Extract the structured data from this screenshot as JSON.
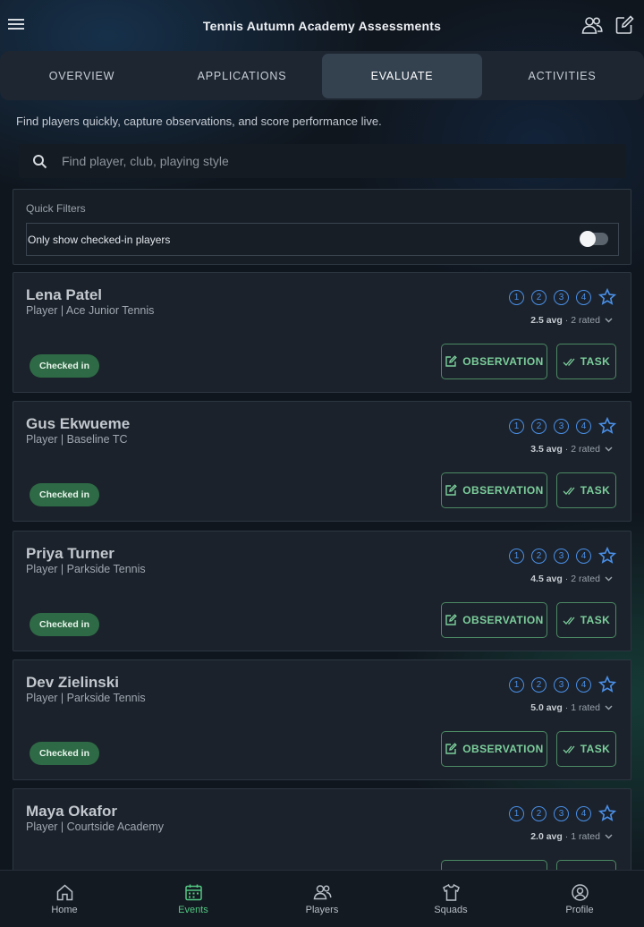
{
  "header": {
    "title": "Tennis Autumn Academy Assessments",
    "icons": {
      "menu": "hamburger-menu-icon",
      "team": "people-icon",
      "edit": "compose-icon"
    }
  },
  "tabs": [
    {
      "label": "OVERVIEW",
      "active": false
    },
    {
      "label": "APPLICATIONS",
      "active": false
    },
    {
      "label": "EVALUATE",
      "active": true
    },
    {
      "label": "ACTIVITIES",
      "active": false
    }
  ],
  "intro": "Find players quickly, capture observations, and score performance live.",
  "search": {
    "placeholder": "Find player, club, playing style",
    "value": ""
  },
  "filters": {
    "label": "Quick Filters",
    "checked_in_only_label": "Only show checked-in players",
    "checked_in_only": false
  },
  "rating_scale": [
    "1",
    "2",
    "3",
    "4"
  ],
  "players": [
    {
      "name": "Lena Patel",
      "sub": "Player | Ace Junior Tennis",
      "avg": "2.5 avg",
      "rated": "2 rated",
      "status": "Checked in"
    },
    {
      "name": "Gus Ekwueme",
      "sub": "Player | Baseline TC",
      "avg": "3.5 avg",
      "rated": "2 rated",
      "status": "Checked in"
    },
    {
      "name": "Priya Turner",
      "sub": "Player | Parkside Tennis",
      "avg": "4.5 avg",
      "rated": "2 rated",
      "status": "Checked in"
    },
    {
      "name": "Dev Zielinski",
      "sub": "Player | Parkside Tennis",
      "avg": "5.0 avg",
      "rated": "1 rated",
      "status": "Checked in"
    },
    {
      "name": "Maya Okafor",
      "sub": "Player | Courtside Academy",
      "avg": "2.0 avg",
      "rated": "1 rated",
      "status": ""
    }
  ],
  "actions": {
    "observation": "OBSERVATION",
    "task": "TASK",
    "rating_separator": "·"
  },
  "nav": [
    {
      "label": "Home",
      "icon": "home-icon",
      "active": false
    },
    {
      "label": "Events",
      "icon": "calendar-icon",
      "active": true
    },
    {
      "label": "Players",
      "icon": "players-icon",
      "active": false
    },
    {
      "label": "Squads",
      "icon": "shirt-icon",
      "active": false
    },
    {
      "label": "Profile",
      "icon": "profile-icon",
      "active": false
    }
  ],
  "colors": {
    "accent_blue": "#4a8fe7",
    "accent_green": "#52c783",
    "badge_green": "#2e6a45"
  }
}
